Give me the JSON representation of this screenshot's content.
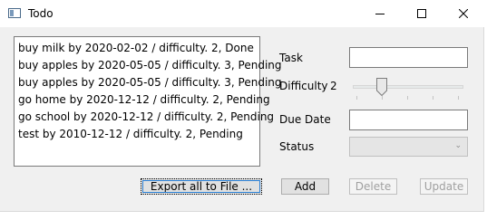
{
  "window": {
    "title": "Todo"
  },
  "todo_list": {
    "items": [
      "buy milk by 2020-02-02 / difficulty. 2, Done",
      "buy apples by 2020-05-05 / difficulty. 3, Pending",
      "buy apples by 2020-05-05 / difficulty. 3, Pending",
      "go home by 2020-12-12 / difficulty. 2, Pending",
      "go school by 2020-12-12 / difficulty. 2, Pending",
      "test by 2010-12-12 / difficulty. 2, Pending"
    ]
  },
  "form": {
    "task_label": "Task",
    "task_value": "",
    "difficulty_label": "Difficulty",
    "difficulty_value": "2",
    "due_date_label": "Due Date",
    "due_date_value": "",
    "status_label": "Status",
    "status_value": ""
  },
  "buttons": {
    "export": "Export all to File ...",
    "add": "Add",
    "delete": "Delete",
    "update": "Update"
  }
}
